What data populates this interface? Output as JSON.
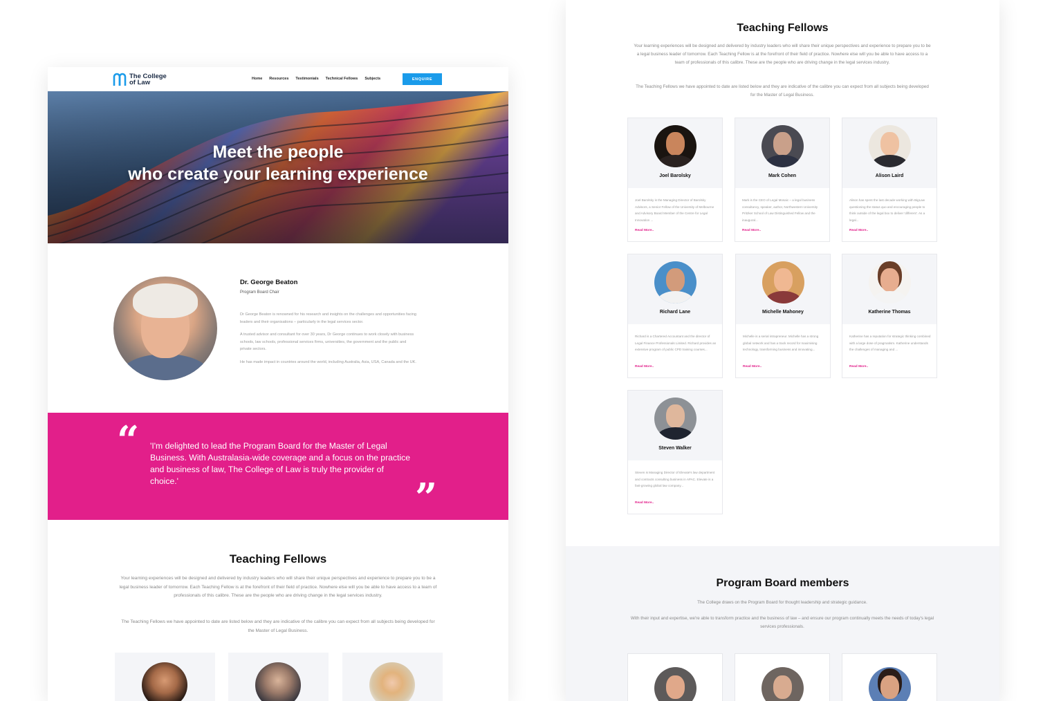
{
  "left": {
    "logo_text": "The College\nof Law",
    "nav": [
      "Home",
      "Resources",
      "Testimonials",
      "Technical Fellows",
      "Subjects"
    ],
    "enquire_label": "ENQUIRE",
    "hero_title_line1": "Meet the people",
    "hero_title_line2": "who create your learning experience",
    "profile": {
      "name": "Dr. George Beaton",
      "role": "Program Board Chair",
      "bio": [
        "Dr George Beaton is renowned for his research and insights on the challenges and opportunities facing leaders and their organisations – particularly in the legal services sector.",
        "A trusted advisor and consultant for over 30 years, Dr George continues to work closely with business schools, law schools, professional services firms, universities, the government and the public and private sectors.",
        "He has made impact in countries around the world, including Australia, Asia, USA, Canada and the UK."
      ]
    },
    "quote": "'I'm delighted to lead the Program Board for the Master of Legal Business. With Australasia-wide coverage and a focus on the practice and business of law, The College of Law is truly the provider of choice.'",
    "teaching_title": "Teaching Fellows",
    "teaching_desc": "Your learning experiences will be designed and delivered by industry leaders who will share their unique perspectives and experience to prepare you to be a legal business leader of tomorrow. Each Teaching Fellow is at the forefront of their field of practice. Nowhere else will you be able to have access to a team of professionals of this calibre. These are the people who are driving change in the legal services industry.",
    "teaching_desc2": "The Teaching Fellows we have appointed to date are listed below and they are indicative of the calibre you can expect from all subjects being developed for the Master of Legal Business."
  },
  "right": {
    "teaching_title": "Teaching Fellows",
    "teaching_desc": "Your learning experiences will be designed and delivered by industry leaders who will share their unique perspectives and experience to prepare you to be a legal business leader of tomorrow. Each Teaching Fellow is at the forefront of their field of practice. Nowhere else will you be able to have access to a team of professionals of this calibre. These are the people who are driving change in the legal services industry.",
    "teaching_desc2": "The Teaching Fellows we have appointed to date are listed below and they are indicative of the calibre you can expect from all subjects being developed for the Master of Legal Business.",
    "read_more": "Read More..",
    "fellows": [
      {
        "name": "Joel Barolsky",
        "bio": "Joel Barolsky is the Managing Director of Barolsky Advisors, a Senior Fellow of the University of Melbourne and Advisory Board Member of the Centre for Legal Innovation ..."
      },
      {
        "name": "Mark Cohen",
        "bio": "Mark is the CEO of Legal Mosaic – a legal business consultancy, speaker, author, Northwestern University Pritzker School of Law Distinguished Fellow and the inaugural..."
      },
      {
        "name": "Alison Laird",
        "bio": "Alison has spent the last decade working with BigLaw questioning the status quo and encouraging people to think outside of the legal box to deliver 'different'. As a legal..."
      },
      {
        "name": "Richard Lane",
        "bio": "Richard is a Chartered Accountant and the director of Legal Finance Professionals Limited. Richard provides an extensive program of public CPD training courses..."
      },
      {
        "name": "Michelle Mahoney",
        "bio": "Michelle is a serial intrapreneur. Michelle has a strong global network and has a track record for maximising technology, transforming business and innovating..."
      },
      {
        "name": "Katherine Thomas",
        "bio": "Katherine has a reputation for strategic thinking combined with a large dose of pragmatism. Katherine understands the challenges of managing and ..."
      },
      {
        "name": "Steven Walker",
        "bio": "Steven is Managing Director of Elevate's law department and contracts consulting business in APAC. Elevate is a fast-growing global law company..."
      }
    ],
    "board_title": "Program Board members",
    "board_desc": "The College draws on the Program Board for thought leadership and strategic guidance.",
    "board_desc2": "With their input and expertise, we're able to transform practice and the business of law – and ensure our program continually meets the needs of today's legal services professionals."
  },
  "colors": {
    "accent_pink": "#e21f8a",
    "button_blue": "#1a9bea"
  }
}
